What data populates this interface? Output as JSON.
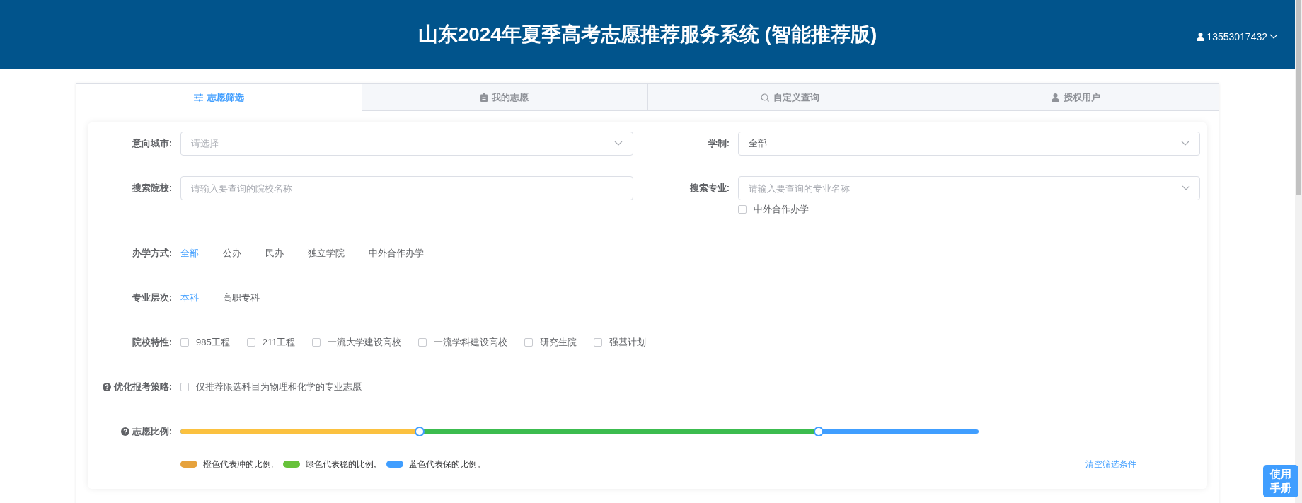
{
  "header": {
    "title": "山东2024年夏季高考志愿推荐服务系统 (智能推荐版)",
    "user": "13553017432"
  },
  "tabs": [
    {
      "label": "志愿筛选",
      "selected": true
    },
    {
      "label": "我的志愿",
      "selected": false
    },
    {
      "label": "自定义查询",
      "selected": false
    },
    {
      "label": "授权用户",
      "selected": false
    }
  ],
  "filters": {
    "city": {
      "label": "意向城市:",
      "placeholder": "请选择"
    },
    "duration": {
      "label": "学制:",
      "value": "全部"
    },
    "school": {
      "label": "搜索院校:",
      "placeholder": "请输入要查询的院校名称"
    },
    "major": {
      "label": "搜索专业:",
      "placeholder": "请输入要查询的专业名称"
    },
    "joint_checkbox": {
      "label": "中外合作办学",
      "checked": false
    },
    "ownership": {
      "label": "办学方式:",
      "options": [
        {
          "label": "全部",
          "selected": true
        },
        {
          "label": "公办",
          "selected": false
        },
        {
          "label": "民办",
          "selected": false
        },
        {
          "label": "独立学院",
          "selected": false
        },
        {
          "label": "中外合作办学",
          "selected": false
        }
      ]
    },
    "level": {
      "label": "专业层次:",
      "options": [
        {
          "label": "本科",
          "selected": true
        },
        {
          "label": "高职专科",
          "selected": false
        }
      ]
    },
    "features": {
      "label": "院校特性:",
      "options": [
        {
          "label": "985工程",
          "checked": false
        },
        {
          "label": "211工程",
          "checked": false
        },
        {
          "label": "一流大学建设高校",
          "checked": false
        },
        {
          "label": "一流学科建设高校",
          "checked": false
        },
        {
          "label": "研究生院",
          "checked": false
        },
        {
          "label": "强基计划",
          "checked": false
        }
      ]
    },
    "strategy": {
      "label": "优化报考策略:",
      "option": {
        "label": "仅推荐限选科目为物理和化学的专业志愿",
        "checked": false
      }
    },
    "ratio": {
      "label": "志愿比例:",
      "thumbs": [
        {
          "level": 0.3
        },
        {
          "level": 0.8
        }
      ],
      "legend": [
        {
          "label": "橙色代表冲的比例,",
          "color": "#e6a23c"
        },
        {
          "label": "绿色代表稳的比例,",
          "color": "#67c23a"
        },
        {
          "label": "蓝色代表保的比例。",
          "color": "#409eff"
        }
      ]
    },
    "clear_link": "清空筛选条件"
  },
  "help_button": "使用手册"
}
